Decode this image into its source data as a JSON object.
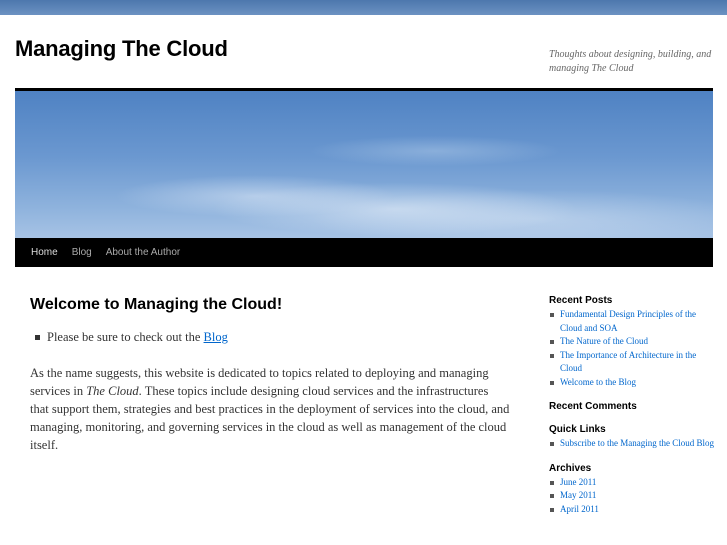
{
  "site": {
    "title": "Managing The Cloud",
    "description": "Thoughts about designing, building, and managing The Cloud"
  },
  "nav": {
    "items": [
      "Home",
      "Blog",
      "About the Author"
    ]
  },
  "main": {
    "heading": "Welcome to Managing the Cloud!",
    "bullet_text": "Please be sure to check out the ",
    "bullet_link": "Blog",
    "para_start": "As the name suggests, this website is dedicated to topics related to deploying and managing services in ",
    "para_italic": "The Cloud",
    "para_end": ". These topics include designing cloud services and the infrastructures that support them, strategies and best practices in the deployment of services into the cloud, and managing, monitoring, and governing services in the cloud as well as management of the cloud itself."
  },
  "sidebar": {
    "recent_posts": {
      "title": "Recent Posts",
      "items": [
        "Fundamental Design Principles of the Cloud and SOA",
        "The Nature of the Cloud",
        "The Importance of Architecture in the Cloud",
        "Welcome to the Blog"
      ]
    },
    "recent_comments": {
      "title": "Recent Comments"
    },
    "quick_links": {
      "title": "Quick Links",
      "items": [
        "Subscribe to the Managing the Cloud Blog"
      ]
    },
    "archives": {
      "title": "Archives",
      "items": [
        "June 2011",
        "May 2011",
        "April 2011"
      ]
    }
  }
}
